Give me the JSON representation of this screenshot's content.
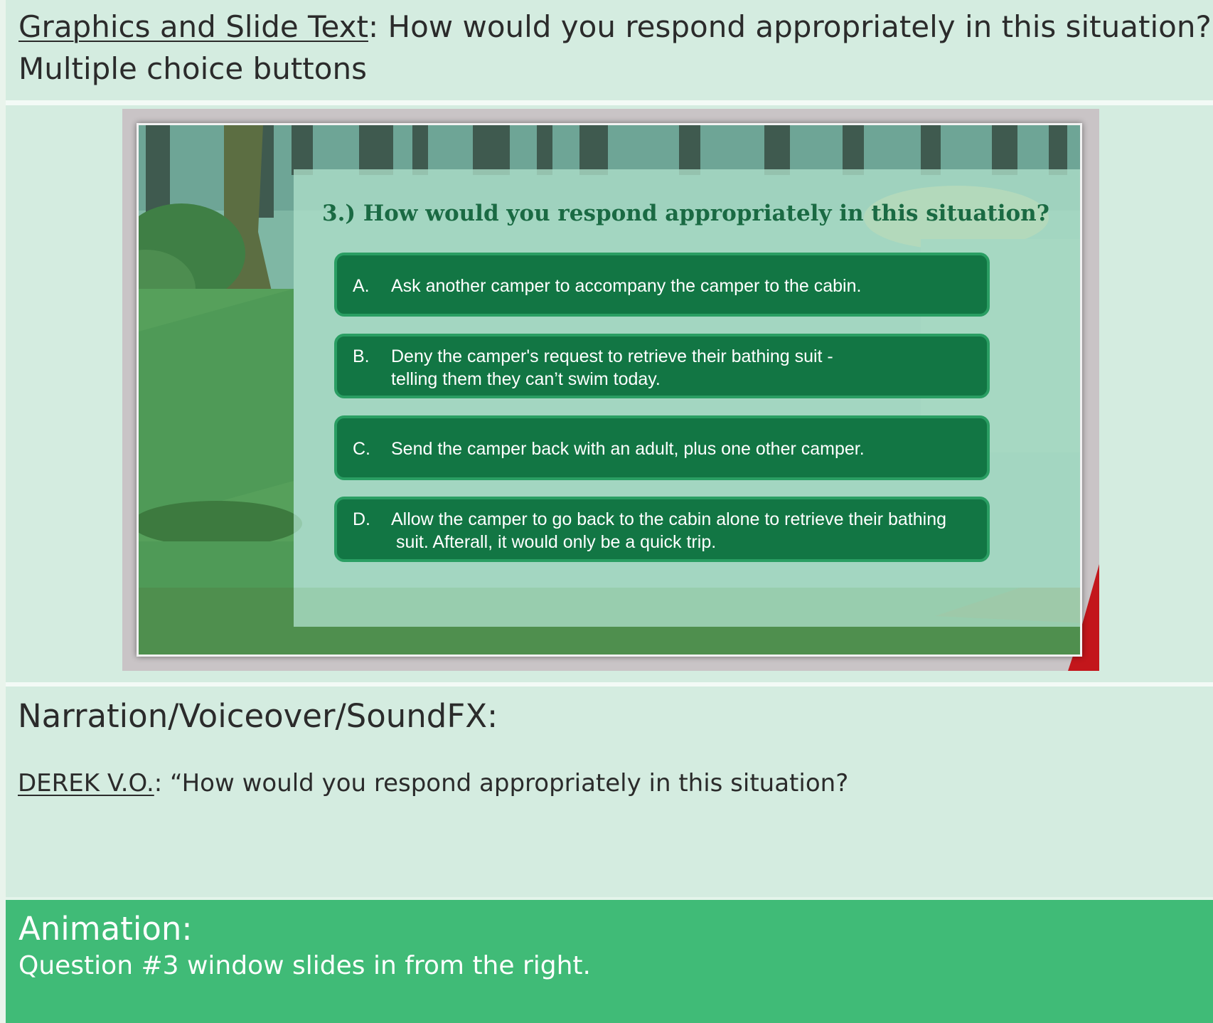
{
  "graphics": {
    "label": "Graphics and Slide Text",
    "colon_text": ": How would you respond appropriately in this situation?",
    "subtitle": "Multiple choice buttons"
  },
  "slide": {
    "question": "3.) How would you respond appropriately in this situation?",
    "options": [
      {
        "letter": "A.",
        "lines": [
          "Ask another camper to accompany the camper to the cabin."
        ]
      },
      {
        "letter": "B.",
        "lines": [
          "Deny the camper's request to retrieve their bathing suit -",
          "telling them they can’t swim today."
        ]
      },
      {
        "letter": "C.",
        "lines": [
          "Send the camper back with an adult, plus one other camper."
        ]
      },
      {
        "letter": "D.",
        "lines": [
          "Allow the camper to go back to the cabin alone to retrieve their bathing",
          " suit. Afterall, it would only be a quick trip."
        ]
      }
    ],
    "colors": {
      "button": "#127644",
      "button_border": "#2a9e63",
      "question_text": "#1a6a43",
      "forest_green": "#4f9a57",
      "panel": "#addfc9"
    }
  },
  "narration": {
    "heading": "Narration/Voiceover/SoundFX:",
    "speaker": "DEREK V.O.",
    "speaker_colon": ":",
    "line": " “How would you respond appropriately in this situation?"
  },
  "animation": {
    "heading": "Animation:",
    "text": "Question #3 window slides in from the right."
  },
  "colors": {
    "section_bg": "#d4ece0",
    "animation_bg": "#40bb77"
  }
}
